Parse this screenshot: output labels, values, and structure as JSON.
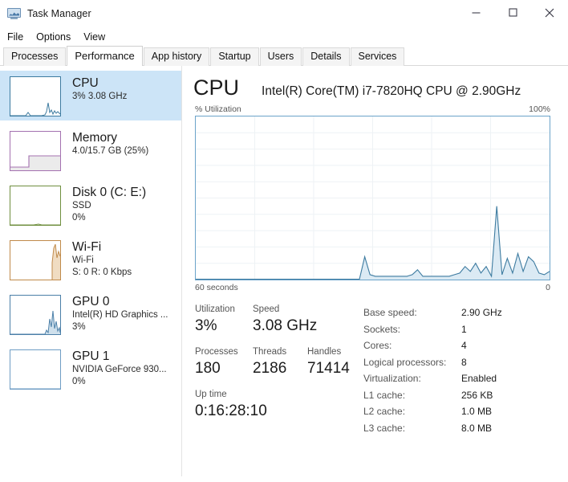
{
  "window": {
    "title": "Task Manager",
    "icon": "task-manager-icon",
    "controls": {
      "minimize": "minimize-icon",
      "maximize": "maximize-icon",
      "close": "close-icon"
    }
  },
  "menu": {
    "items": [
      "File",
      "Options",
      "View"
    ]
  },
  "tabs": {
    "items": [
      "Processes",
      "Performance",
      "App history",
      "Startup",
      "Users",
      "Details",
      "Services"
    ],
    "active": "Performance"
  },
  "sidebar": {
    "items": [
      {
        "name": "CPU",
        "sub1": "3%  3.08 GHz",
        "sub2": "",
        "selected": true,
        "color": "#3d7ba0"
      },
      {
        "name": "Memory",
        "sub1": "4.0/15.7 GB (25%)",
        "sub2": "",
        "selected": false,
        "color": "#a471b0"
      },
      {
        "name": "Disk 0 (C: E:)",
        "sub1": "SSD",
        "sub2": "0%",
        "selected": false,
        "color": "#6f8f3f"
      },
      {
        "name": "Wi-Fi",
        "sub1": "Wi-Fi",
        "sub2": "S: 0 R: 0 Kbps",
        "selected": false,
        "color": "#c08a4a"
      },
      {
        "name": "GPU 0",
        "sub1": "Intel(R) HD Graphics ...",
        "sub2": "3%",
        "selected": false,
        "color": "#4b7fa8"
      },
      {
        "name": "GPU 1",
        "sub1": "NVIDIA GeForce 930...",
        "sub2": "0%",
        "selected": false,
        "color": "#6f9dc4"
      }
    ]
  },
  "main": {
    "heading": "CPU",
    "model": "Intel(R) Core(TM) i7-7820HQ CPU @ 2.90GHz",
    "graph_label_left": "% Utilization",
    "graph_label_right": "100%",
    "time_label_left": "60 seconds",
    "time_label_right": "0",
    "stats": [
      {
        "label": "Utilization",
        "value": "3%"
      },
      {
        "label": "Speed",
        "value": "3.08 GHz"
      },
      {
        "label": "Processes",
        "value": "180"
      },
      {
        "label": "Threads",
        "value": "2186"
      },
      {
        "label": "Handles",
        "value": "71414"
      },
      {
        "label": "Up time",
        "value": "0:16:28:10"
      }
    ],
    "specs": [
      {
        "key": "Base speed:",
        "value": "2.90 GHz"
      },
      {
        "key": "Sockets:",
        "value": "1"
      },
      {
        "key": "Cores:",
        "value": "4"
      },
      {
        "key": "Logical processors:",
        "value": "8"
      },
      {
        "key": "Virtualization:",
        "value": "Enabled"
      },
      {
        "key": "L1 cache:",
        "value": "256 KB"
      },
      {
        "key": "L2 cache:",
        "value": "1.0 MB"
      },
      {
        "key": "L3 cache:",
        "value": "8.0 MB"
      }
    ]
  },
  "chart_data": {
    "type": "area",
    "title": "% Utilization",
    "xlabel": "seconds",
    "ylabel": "% Utilization",
    "ylim": [
      0,
      100
    ],
    "xlim": [
      60,
      0
    ],
    "grid": true,
    "grid_rows": 10,
    "grid_cols": 6,
    "line_color": "#3d7ba0",
    "fill_color": "#dbeaf4",
    "x": [
      60,
      59,
      58,
      57,
      56,
      55,
      54,
      53,
      52,
      51,
      50,
      49,
      48,
      47,
      46,
      45,
      44,
      43,
      42,
      41,
      40,
      39,
      38,
      37,
      36,
      35,
      34,
      33,
      32,
      31,
      30,
      29,
      28,
      27,
      26,
      25,
      24,
      23,
      22,
      21,
      20,
      19,
      18,
      17,
      16,
      15,
      14,
      13,
      12,
      11,
      10,
      9,
      8,
      7,
      6,
      5,
      4,
      3,
      2,
      1,
      0
    ],
    "values": [
      0,
      0,
      0,
      0,
      0,
      0,
      0,
      0,
      0,
      0,
      0,
      0,
      0,
      0,
      0,
      0,
      0,
      0,
      0,
      0,
      0,
      0,
      0,
      0,
      0,
      0,
      0,
      0,
      0,
      0,
      0,
      0,
      14,
      3,
      2,
      2,
      2,
      2,
      2,
      2,
      2,
      3,
      6,
      2,
      2,
      2,
      2,
      2,
      2,
      3,
      4,
      8,
      5,
      10,
      4,
      8,
      2,
      45,
      3,
      13,
      4,
      16,
      5,
      14,
      11,
      4,
      3,
      5
    ]
  }
}
